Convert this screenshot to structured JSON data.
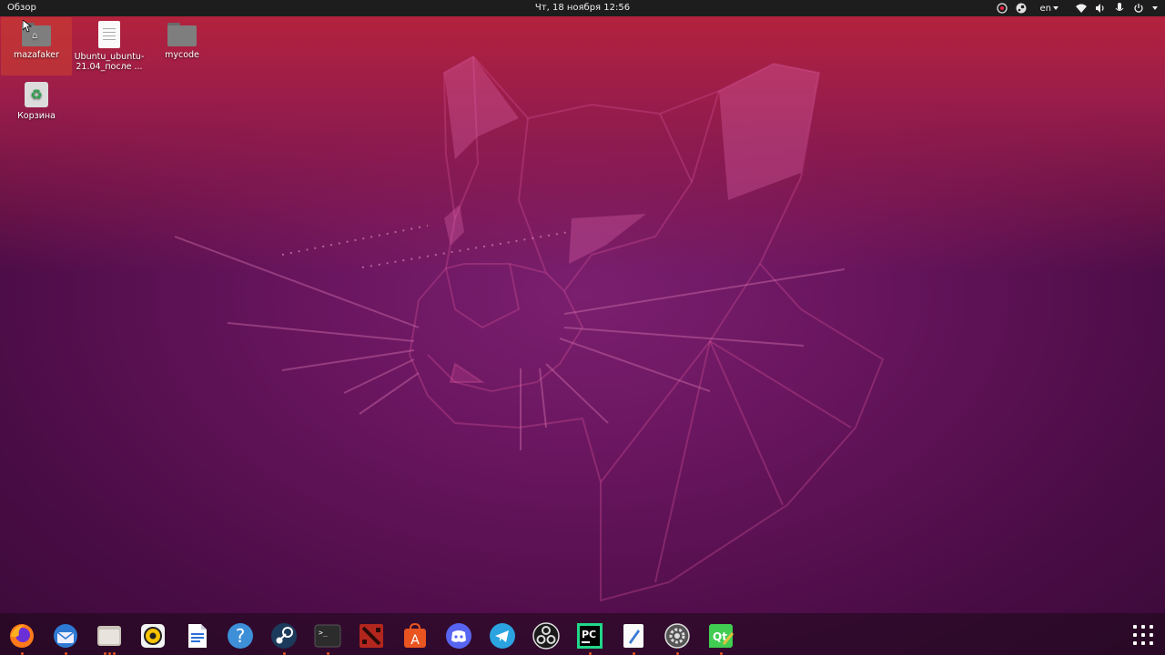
{
  "topbar": {
    "activities_label": "Обзор",
    "clock": "Чт, 18 ноября  12:56",
    "language": "en"
  },
  "desktop": {
    "icons": [
      {
        "label": "mazafaker",
        "type": "home-folder"
      },
      {
        "label": "Ubuntu_ubuntu-21.04_после ...",
        "type": "document"
      },
      {
        "label": "mycode",
        "type": "folder"
      },
      {
        "label": "Корзина",
        "type": "trash"
      }
    ]
  },
  "dock": {
    "apps": [
      {
        "name": "firefox",
        "running": true
      },
      {
        "name": "thunderbird",
        "running": true
      },
      {
        "name": "files",
        "running": true
      },
      {
        "name": "rhythmbox",
        "running": false
      },
      {
        "name": "libreoffice-writer",
        "running": false
      },
      {
        "name": "help",
        "running": false
      },
      {
        "name": "steam",
        "running": true
      },
      {
        "name": "terminal",
        "running": true
      },
      {
        "name": "dota-2",
        "running": false
      },
      {
        "name": "software-center",
        "running": false
      },
      {
        "name": "discord",
        "running": false
      },
      {
        "name": "telegram",
        "running": false
      },
      {
        "name": "obs-studio",
        "running": false
      },
      {
        "name": "pycharm",
        "running": true
      },
      {
        "name": "text-editor",
        "running": true
      },
      {
        "name": "settings",
        "running": true
      },
      {
        "name": "qt-creator",
        "running": true
      }
    ]
  },
  "colors": {
    "accent": "#e95420",
    "topbar": "#1d1d1d"
  }
}
